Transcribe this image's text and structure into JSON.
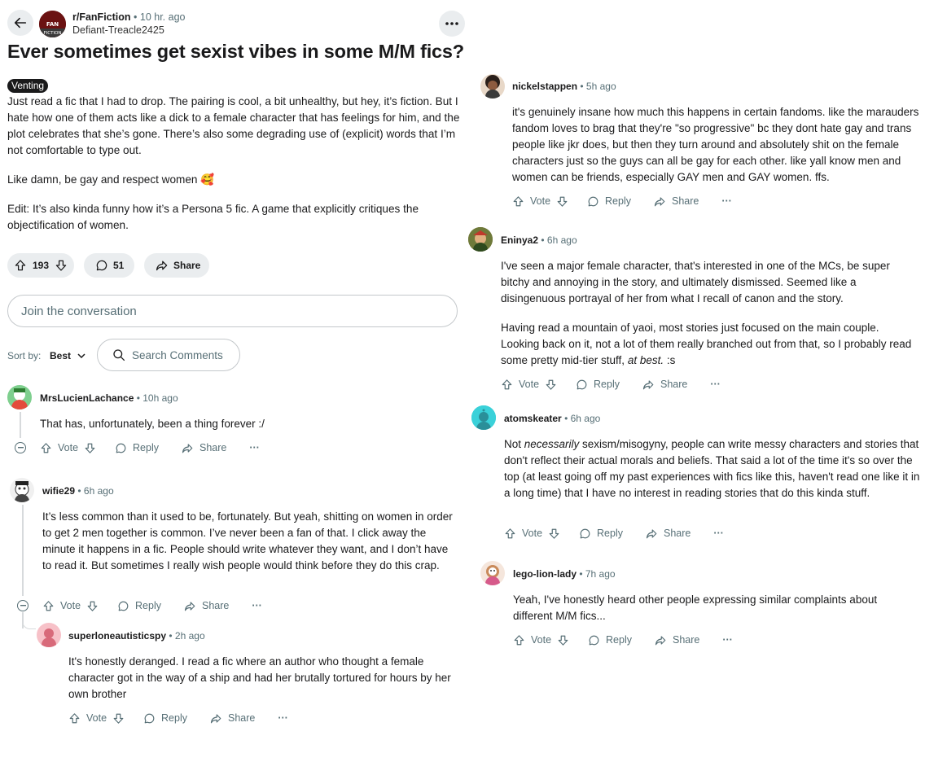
{
  "post": {
    "subreddit": "r/FanFiction",
    "subreddit_logo_text": "FAN FICTION",
    "time": "• 10 hr. ago",
    "author": "Defiant-Treacle2425",
    "title": "Ever sometimes get sexist vibes in some M/M fics?",
    "flair": "Venting",
    "body": [
      "Just read a fic that I had to drop. The pairing is cool, a bit unhealthy, but hey, it’s fiction. But I hate how one of them acts like a dick to a female character that has feelings for him, and the plot celebrates that she’s gone. There’s also some degrading use of (explicit) words that I’m not comfortable to type out.",
      "Like damn, be gay and respect women 🥰",
      "Edit: It’s also kinda funny how it’s a Persona 5 fic. A game that explicitly critiques the objectification of women."
    ],
    "votes": "193",
    "comments": "51",
    "share_label": "Share"
  },
  "composer": {
    "placeholder": "Join the conversation"
  },
  "sort": {
    "label": "Sort by:",
    "value": "Best"
  },
  "search": {
    "placeholder": "Search Comments"
  },
  "actions": {
    "vote": "Vote",
    "reply": "Reply",
    "share": "Share",
    "more": "···"
  },
  "comments": [
    {
      "user": "MrsLucienLachance",
      "time": "• 10h ago",
      "text": "That has, unfortunately, been a thing forever :/"
    },
    {
      "user": "wifie29",
      "time": "• 6h ago",
      "text": "It’s less common than it used to be, fortunately. But yeah, shitting on women in order to get 2 men together is common. I’ve never been a fan of that. I click away the minute it happens in a fic. People should write whatever they want, and I don’t have to read it. But sometimes I really wish people would think before they do this crap."
    },
    {
      "user": "superloneautisticspy",
      "time": "• 2h ago",
      "text": "It's honestly deranged. I read a fic where an author who thought a female character got in the way of a ship and had her brutally tortured for hours by her own brother"
    },
    {
      "user": "nickelstappen",
      "time": "• 5h ago",
      "text": "it's genuinely insane how much this happens in certain fandoms. like the marauders fandom loves to brag that they're \"so progressive\" bc they dont hate gay and trans people like jkr does, but then they turn around and absolutely shit on the female characters just so the guys can all be gay for each other. like yall know men and women can be friends, especially GAY men and GAY women. ffs."
    },
    {
      "user": "Eninya2",
      "time": "• 6h ago",
      "text": "I've seen a major female character, that's interested in one of the MCs, be super bitchy and annoying in the story, and ultimately dismissed. Seemed like a disingenuous portrayal of her from what I recall of canon and the story.",
      "text2": "Having read a mountain of yaoi, most stories just focused on the main couple. Looking back on it, not a lot of them really branched out from that, so I probably read some pretty mid-tier stuff, ",
      "text2_em": "at best.",
      "text2_end": " :s"
    },
    {
      "user": "atomskeater",
      "time": "• 6h ago",
      "text_pre": "Not ",
      "text_em": "necessarily",
      "text_post": " sexism/misogyny, people can write messy characters and stories that don't reflect their actual morals and beliefs. That said a lot of the time it's so over the top (at least going off my past experiences with fics like this, haven't read one like it in a long time) that I have no interest in reading stories that do this kinda stuff."
    },
    {
      "user": "lego-lion-lady",
      "time": "• 7h ago",
      "text": "Yeah, I've honestly heard other people expressing similar complaints about different M/M fics..."
    }
  ]
}
